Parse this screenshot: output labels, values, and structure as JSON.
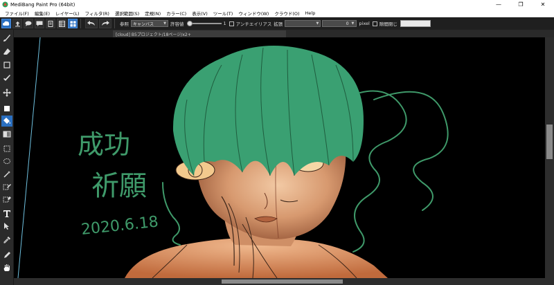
{
  "window": {
    "title": "MediBang Paint Pro (64bit)",
    "minimize_glyph": "—",
    "maximize_glyph": "❐",
    "close_glyph": "✕"
  },
  "menu": {
    "items": [
      "ファイル(F)",
      "編集(E)",
      "レイヤー(L)",
      "フィルタ(R)",
      "選択範囲(S)",
      "定規(N)",
      "カラー(C)",
      "表示(V)",
      "ツール(T)",
      "ウィンドウ(W)",
      "クラウド(O)",
      "Help"
    ]
  },
  "toolbar": {
    "reference_label": "参照",
    "reference_value": "キャンバス",
    "tolerance_label": "許容値",
    "tolerance_value": "1",
    "antialias_label": "アンチエイリアス",
    "expand_label": "拡張",
    "expand_value": "0",
    "expand_unit": "pixel",
    "close_gap_label": "隙間閉じ"
  },
  "document": {
    "tab_title": "[cloud] B5プロジェクト/18ページ/x2+"
  },
  "canvas": {
    "handwriting": {
      "line1": "成功",
      "line2": "祈願",
      "line3": "2020.6.18"
    },
    "colors": {
      "hair": "#3aa072",
      "handwriting": "#3f9a6a",
      "skin": "#e8b48c",
      "background": "#000000"
    }
  },
  "icons": {
    "tools": [
      "brush-icon",
      "eraser-icon",
      "dot-icon",
      "pen-icon",
      "move-icon",
      "fill-shape-icon",
      "bucket-icon",
      "gradient-icon",
      "select-rect-icon",
      "lasso-icon",
      "magic-wand-icon",
      "select-pen-icon",
      "select-eraser-icon",
      "text-icon",
      "operation-icon",
      "eyedropper-icon",
      "dropper-icon",
      "hand-icon"
    ]
  }
}
